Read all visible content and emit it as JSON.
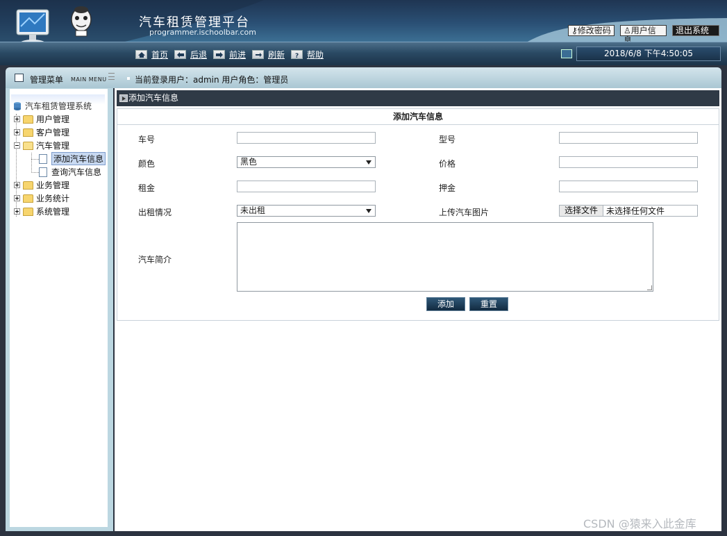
{
  "header": {
    "title": "汽车租赁管理平台",
    "subtitle": "programmer.ischoolbar.com",
    "change_password": "修改密码",
    "user_info": "用户信息",
    "logout": "退出系统"
  },
  "navbar": {
    "home": "首页",
    "back": "后退",
    "forward": "前进",
    "refresh": "刷新",
    "help": "帮助",
    "datetime": "2018/6/8 下午4:50:05"
  },
  "infobar": {
    "menu_title": "管理菜单",
    "menu_title_en": "MAIN MENU",
    "login_info": "当前登录用户：admin  用户角色：管理员"
  },
  "sidebar": {
    "root": "汽车租赁管理系统",
    "items": [
      {
        "label": "用户管理",
        "expanded": false
      },
      {
        "label": "客户管理",
        "expanded": false
      },
      {
        "label": "汽车管理",
        "expanded": true,
        "children": [
          "添加汽车信息",
          "查询汽车信息"
        ]
      },
      {
        "label": "业务管理",
        "expanded": false
      },
      {
        "label": "业务统计",
        "expanded": false
      },
      {
        "label": "系统管理",
        "expanded": false
      }
    ],
    "selected": "添加汽车信息"
  },
  "main": {
    "section_title": "添加汽车信息",
    "form": {
      "title": "添加汽车信息",
      "labels": {
        "car_no": "车号",
        "model": "型号",
        "color": "颜色",
        "price": "价格",
        "rent": "租金",
        "deposit": "押金",
        "rental_status": "出租情况",
        "upload_image": "上传汽车图片",
        "intro": "汽车简介"
      },
      "values": {
        "car_no": "",
        "model": "",
        "color": "黑色",
        "price": "",
        "rent": "",
        "deposit": "",
        "rental_status": "未出租",
        "intro": ""
      },
      "file_button": "选择文件",
      "file_status": "未选择任何文件",
      "add_button": "添加",
      "reset_button": "重置"
    }
  },
  "watermark": "CSDN @猿来入此金库"
}
